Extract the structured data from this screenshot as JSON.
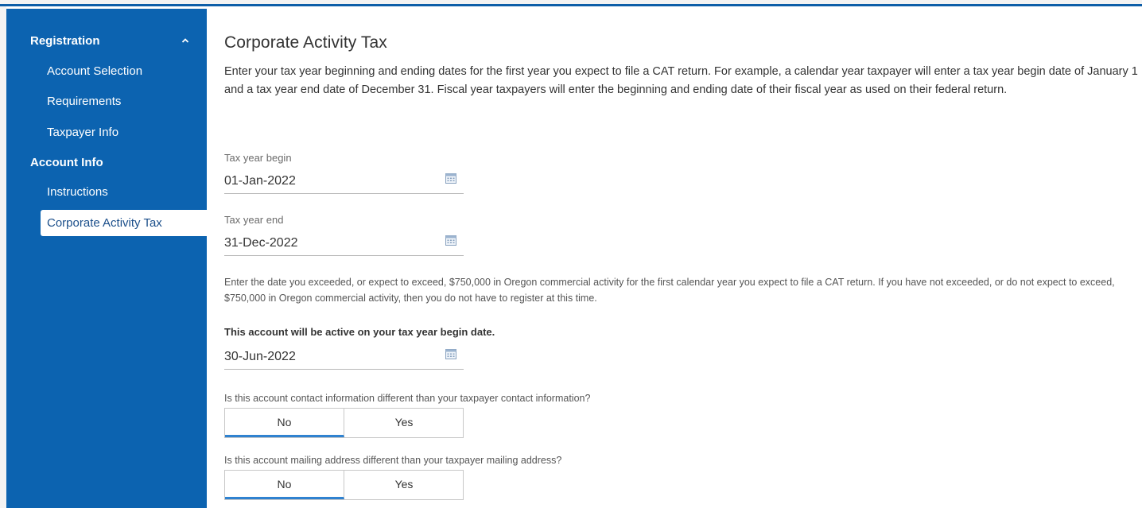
{
  "sidebar": {
    "registration_label": "Registration",
    "items_registration": [
      {
        "label": "Account Selection"
      },
      {
        "label": "Requirements"
      },
      {
        "label": "Taxpayer Info"
      }
    ],
    "account_info_label": "Account Info",
    "items_account": [
      {
        "label": "Instructions"
      },
      {
        "label": "Corporate Activity Tax",
        "active": true
      }
    ]
  },
  "main": {
    "title": "Corporate Activity Tax",
    "intro": "Enter your tax year beginning and ending dates for the first year you expect to file a CAT return. For example, a calendar year taxpayer will enter a tax year begin date of January 1 and a tax year end date of December 31. Fiscal year taxpayers will enter the beginning and ending date of their fiscal year as used on their federal return.",
    "tax_year_begin": {
      "label": "Tax year begin",
      "value": "01-Jan-2022"
    },
    "tax_year_end": {
      "label": "Tax year end",
      "value": "31-Dec-2022"
    },
    "note": "Enter the date you exceeded, or expect to exceed, $750,000 in Oregon commercial activity for the first calendar year you expect to file a CAT return. If you have not exceeded, or do not expect to exceed, $750,000 in Oregon commercial activity, then you do not have to register at this time.",
    "active_date": {
      "label": "This account will be active on your tax year begin date.",
      "value": "30-Jun-2022"
    },
    "question_contact": {
      "text": "Is this account contact information different than your taxpayer contact information?",
      "no": "No",
      "yes": "Yes",
      "selected": "No"
    },
    "question_mailing": {
      "text": "Is this account mailing address different than your taxpayer mailing address?",
      "no": "No",
      "yes": "Yes",
      "selected": "No"
    }
  },
  "colors": {
    "sidebar_bg": "#0c63b0",
    "accent": "#2f82d0",
    "top_border": "#0d5ea8"
  },
  "icons": {
    "collapse": "chevron-up-icon",
    "date": "calendar-icon"
  }
}
